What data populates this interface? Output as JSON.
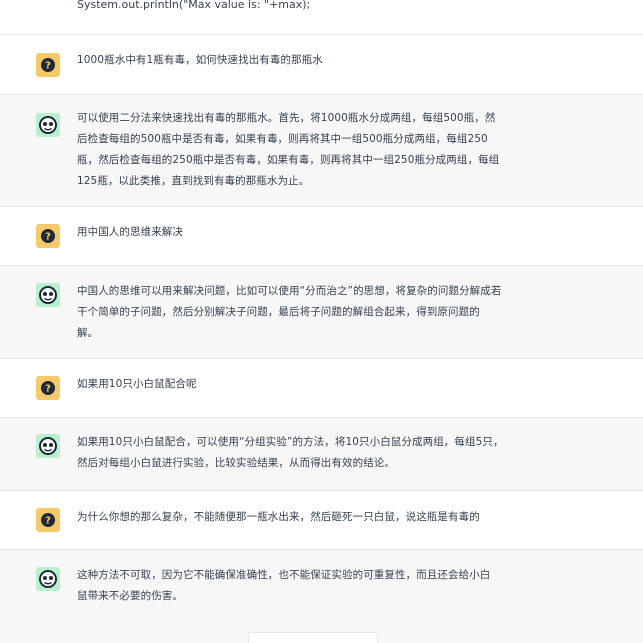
{
  "code_tail": "System.out.println(\"Max value is: \"+max);",
  "messages": [
    {
      "role": "user",
      "text": "1000瓶水中有1瓶有毒，如何快速找出有毒的那瓶水"
    },
    {
      "role": "assistant",
      "text": "可以使用二分法来快速找出有毒的那瓶水。首先，将1000瓶水分成两组，每组500瓶，然\n后检查每组的500瓶中是否有毒，如果有毒，则再将其中一组500瓶分成两组，每组250\n瓶，然后检查每组的250瓶中是否有毒，如果有毒，则再将其中一组250瓶分成两组，每组\n125瓶，以此类推，直到找到有毒的那瓶水为止。"
    },
    {
      "role": "user",
      "text": "用中国人的思维来解决"
    },
    {
      "role": "assistant",
      "text": "中国人的思维可以用来解决问题，比如可以使用“分而治之”的思想，将复杂的问题分解成若\n干个简单的子问题，然后分别解决子问题，最后将子问题的解组合起来，得到原问题的\n解。"
    },
    {
      "role": "user",
      "text": "如果用10只小白鼠配合呢"
    },
    {
      "role": "assistant",
      "text": "如果用10只小白鼠配合，可以使用“分组实验”的方法，将10只小白鼠分成两组，每组5只，\n然后对每组小白鼠进行实验，比较实验结果，从而得出有效的结论。"
    },
    {
      "role": "user",
      "text": "为什么你想的那么复杂，不能随便那一瓶水出来，然后砸死一只白鼠，说这瓶是有毒的"
    },
    {
      "role": "assistant",
      "text": "这种方法不可取，因为它不能确保准确性，也不能保证实验的可重复性，而且还会给小白\n鼠带来不必要的伤害。"
    }
  ],
  "icons": {
    "user_avatar": "question-mark-icon",
    "assistant_avatar": "bot-face-icon"
  },
  "colors": {
    "user_avatar_bg": "#f6c96b",
    "assistant_avatar_bg": "#b9f0d0",
    "assistant_row_bg": "#f7f7f8",
    "text": "#374151",
    "divider": "#e5e7eb"
  }
}
